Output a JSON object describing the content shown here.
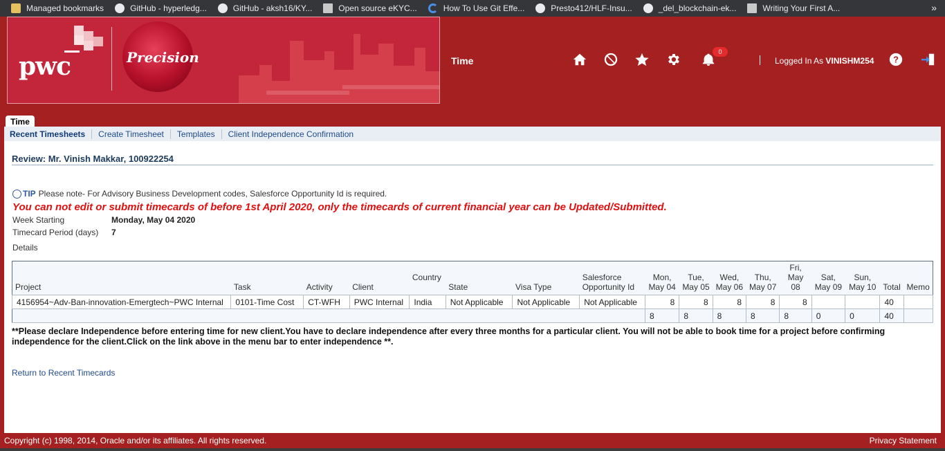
{
  "bookmarks": [
    {
      "label": "Managed bookmarks",
      "icon": "folder-icon"
    },
    {
      "label": "GitHub - hyperledg...",
      "icon": "github-icon"
    },
    {
      "label": "GitHub - aksh16/KY...",
      "icon": "github-icon"
    },
    {
      "label": "Open source eKYC...",
      "icon": "doc-icon"
    },
    {
      "label": "How To Use Git Effe...",
      "icon": "loading-icon"
    },
    {
      "label": "Presto412/HLF-Insu...",
      "icon": "github-icon"
    },
    {
      "label": "_del_blockchain-ek...",
      "icon": "github-icon"
    },
    {
      "label": "Writing Your First A...",
      "icon": "doc-icon"
    }
  ],
  "bookmarks_more": "»",
  "header": {
    "brand": "pwc",
    "product": "Precision",
    "app_title": "Time",
    "notification_count": "0",
    "logged_in_prefix": "Logged In As",
    "username": "VINISHM254"
  },
  "tab": {
    "label": "Time"
  },
  "subnav": [
    "Recent Timesheets",
    "Create Timesheet",
    "Templates",
    "Client Independence Confirmation"
  ],
  "review": {
    "title": "Review: Mr. Vinish Makkar, 100922254",
    "tip_label": "TIP",
    "tip_text": "Please note- For Advisory Business Development codes, Salesforce Opportunity Id is required.",
    "warning": "You can not edit or submit timecards of before 1st April 2020, only the timecards of current financial year can be Updated/Submitted",
    "week_starting_label": "Week Starting",
    "week_starting_value": "Monday, May 04 2020",
    "period_label": "Timecard Period (days)",
    "period_value": "7",
    "details_label": "Details"
  },
  "table": {
    "headers": {
      "project": "Project",
      "task": "Task",
      "activity": "Activity",
      "client": "Client",
      "country": "Country",
      "state": "State",
      "visa": "Visa Type",
      "sf1": "Salesforce",
      "sf2": "Opportunity Id",
      "total": "Total",
      "memo": "Memo"
    },
    "days": [
      {
        "d": "Mon,",
        "date": "May 04"
      },
      {
        "d": "Tue,",
        "date": "May 05"
      },
      {
        "d": "Wed,",
        "date": "May 06"
      },
      {
        "d": "Thu,",
        "date": "May 07"
      },
      {
        "d": "Fri,",
        "date": "May 08"
      },
      {
        "d": "Sat,",
        "date": "May 09"
      },
      {
        "d": "Sun,",
        "date": "May 10"
      }
    ],
    "row": {
      "project": "4156954~Adv-Ban-innovation-Emergtech~PWC Internal",
      "task": "0101-Time Cost",
      "activity": "CT-WFH",
      "client": "PWC Internal",
      "country": "India",
      "state": "Not Applicable",
      "visa": "Not Applicable",
      "sf": "Not Applicable",
      "hours": [
        "8",
        "8",
        "8",
        "8",
        "8",
        "",
        ""
      ],
      "total": "40"
    },
    "totals": {
      "hours": [
        "8",
        "8",
        "8",
        "8",
        "8",
        "0",
        "0"
      ],
      "total": "40"
    }
  },
  "notice": "**Please declare Independence before entering time for new client.You have to declare independence after every three months for a particular client. You will not be able to book time for a project before confirming independence for the client.Click on the link above in the menu bar to enter independence **",
  "return_link": "Return to Recent Timecards",
  "footer": {
    "copyright": "Copyright (c) 1998, 2014, Oracle and/or its affiliates. All rights reserved.",
    "privacy": "Privacy Statement"
  },
  "colors": {
    "brand_red": "#a52121",
    "warning_red": "#e01010",
    "link_blue": "#1e4a8c"
  }
}
